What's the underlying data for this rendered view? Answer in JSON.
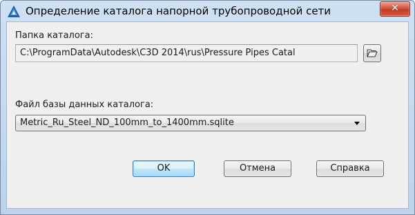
{
  "window": {
    "title": "Определение каталога напорной трубопроводной сети",
    "close_label": "✕"
  },
  "catalog_folder": {
    "label": "Папка каталога:",
    "value": "C:\\ProgramData\\Autodesk\\C3D 2014\\rus\\Pressure Pipes Catal"
  },
  "database_file": {
    "label": "Файл базы данных каталога:",
    "selected": "Metric_Ru_Steel_ND_100mm_to_1400mm.sqlite"
  },
  "buttons": {
    "ok": "OK",
    "cancel": "Отмена",
    "help": "Справка"
  },
  "icons": {
    "app": "autodesk-civil3d-icon",
    "browse": "open-folder-icon",
    "dropdown": "chevron-down-icon"
  },
  "colors": {
    "titlebar": "#bcd3ee",
    "close_button": "#c23a22",
    "app_icon": "#1f5fb0"
  }
}
